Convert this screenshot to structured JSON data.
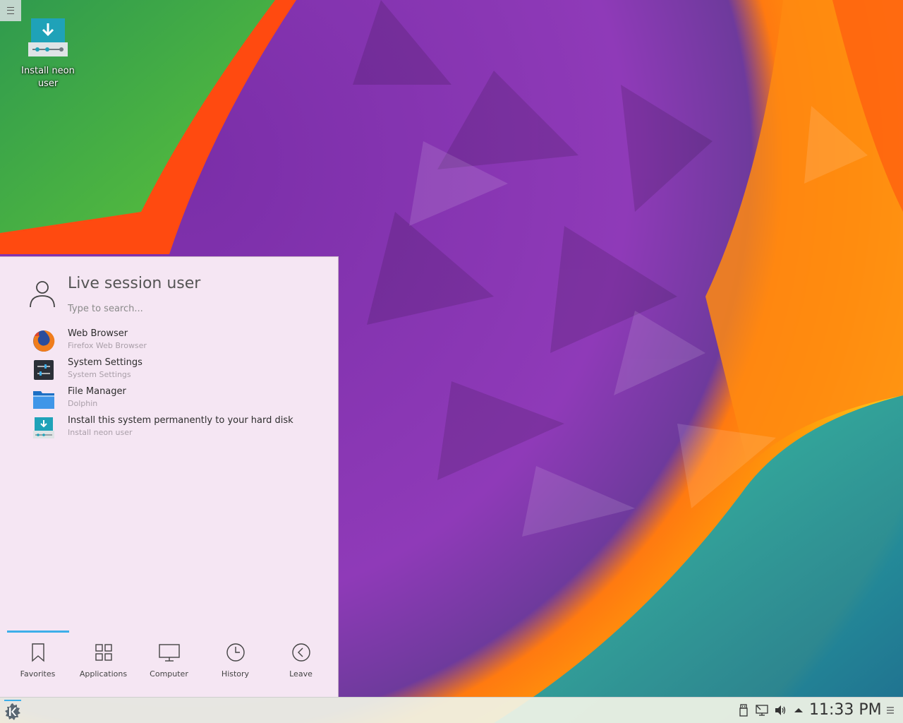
{
  "desktop": {
    "icon_label": "Install neon user",
    "toolbox_icon": "hamburger-menu-icon"
  },
  "launcher": {
    "user_name": "Live session user",
    "search_placeholder": "Type to search...",
    "favorites": [
      {
        "name": "Web Browser",
        "description": "Firefox Web Browser",
        "icon": "firefox-icon"
      },
      {
        "name": "System Settings",
        "description": "System Settings",
        "icon": "system-settings-icon"
      },
      {
        "name": "File Manager",
        "description": "Dolphin",
        "icon": "folder-icon"
      },
      {
        "name": "Install this system permanently to your hard disk",
        "description": "Install neon user",
        "icon": "installer-icon"
      }
    ],
    "tabs": [
      {
        "label": "Favorites",
        "icon": "bookmark-icon",
        "active": true
      },
      {
        "label": "Applications",
        "icon": "grid-icon"
      },
      {
        "label": "Computer",
        "icon": "monitor-icon"
      },
      {
        "label": "History",
        "icon": "clock-icon"
      },
      {
        "label": "Leave",
        "icon": "leave-icon"
      }
    ]
  },
  "taskbar": {
    "clock": "11:33 PM",
    "tray_icons": [
      "usb-icon",
      "network-icon",
      "volume-icon",
      "expand-arrow-icon"
    ],
    "launcher_icon": "kde-logo-icon"
  },
  "colors": {
    "accent": "#3daee9",
    "launcher_bg": "#f5e6f3",
    "taskbar_bg": "#f0f3e6"
  }
}
